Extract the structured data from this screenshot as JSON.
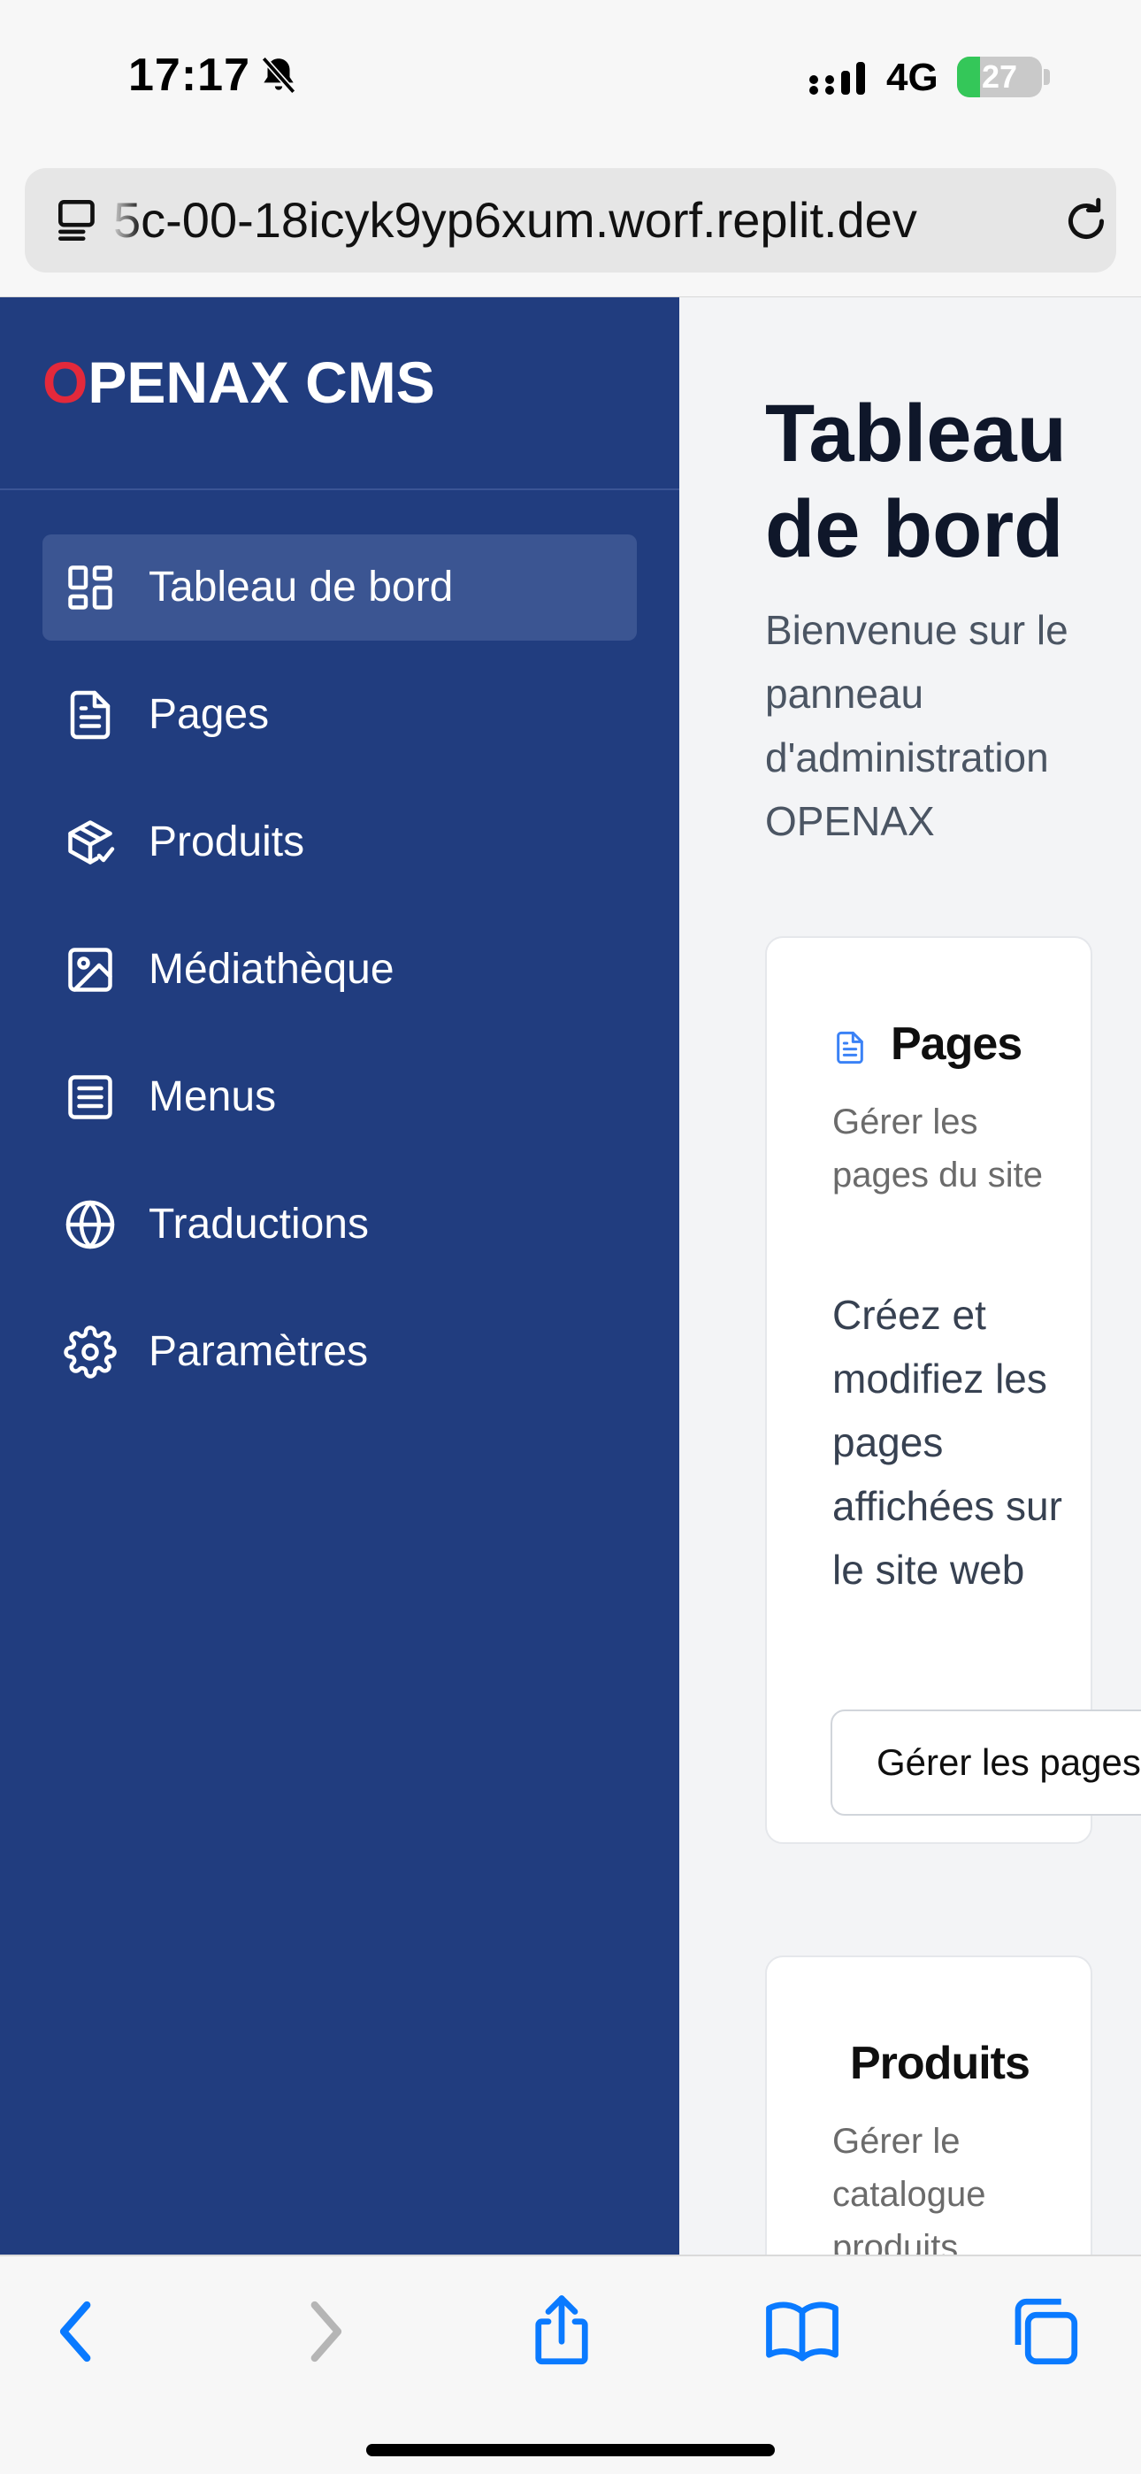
{
  "status_bar": {
    "time": "17:17",
    "network": "4G",
    "battery_level": "27",
    "battery_fraction": 0.27,
    "icons": [
      "bell-slash-icon",
      "signal-icon"
    ]
  },
  "browser": {
    "url": "5c-00-18icyk9yp6xum.worf.replit.dev",
    "icons": [
      "tabs-menu-icon",
      "reload-icon"
    ],
    "toolbar_icons": [
      "back-icon",
      "forward-icon",
      "share-icon",
      "bookmarks-icon",
      "tabs-icon"
    ]
  },
  "sidebar": {
    "brand_first_letter": "O",
    "brand_rest": "PENAX CMS",
    "items": [
      {
        "label": "Tableau de bord",
        "icon": "dashboard-icon",
        "active": true
      },
      {
        "label": "Pages",
        "icon": "document-icon"
      },
      {
        "label": "Produits",
        "icon": "package-icon"
      },
      {
        "label": "Médiathèque",
        "icon": "image-icon"
      },
      {
        "label": "Menus",
        "icon": "list-icon"
      },
      {
        "label": "Traductions",
        "icon": "globe-icon"
      },
      {
        "label": "Paramètres",
        "icon": "gear-icon"
      }
    ]
  },
  "main": {
    "title": "Tableau de bord",
    "subtitle": "Bienvenue sur le panneau d'administration OPENAX",
    "cards": [
      {
        "title": "Pages",
        "icon": "document-icon",
        "description": "Gérer les pages du site",
        "body": "Créez et modifiez les pages affichées sur le site web",
        "button": "Gérer les pages"
      },
      {
        "title": "Produits",
        "description": "Gérer le catalogue produits"
      }
    ]
  },
  "colors": {
    "sidebar_bg": "#213d7f",
    "sidebar_active": "#3b5592",
    "brand_accent": "#e3293b",
    "ios_blue": "#0a7aff",
    "card_icon": "#3b82f6"
  }
}
